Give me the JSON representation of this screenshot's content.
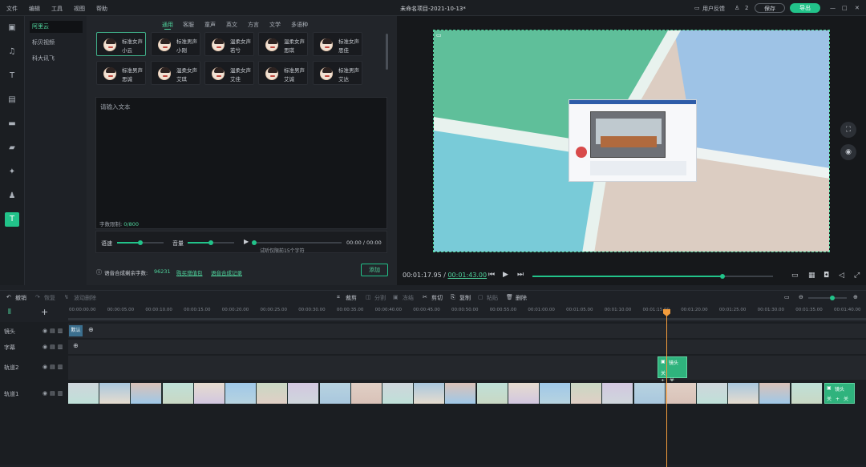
{
  "menu": [
    "文件",
    "编辑",
    "工具",
    "视图",
    "帮助"
  ],
  "window_title": "未命名项目-2021-10-13*",
  "topbar": {
    "feedback": "用户反馈",
    "user": "2",
    "save": "保存",
    "export": "导出",
    "minimize": "—",
    "maximize": "□",
    "close": "✕"
  },
  "providers": [
    "阿里云",
    "标贝视频",
    "科大讯飞"
  ],
  "voice_tabs": [
    "通用",
    "客服",
    "童声",
    "英文",
    "方言",
    "文学",
    "多语种"
  ],
  "voices": [
    {
      "line1": "标准女声",
      "line2": "小云"
    },
    {
      "line1": "标准男声",
      "line2": "小刚"
    },
    {
      "line1": "温柔女声",
      "line2": "若兮"
    },
    {
      "line1": "温柔女声",
      "line2": "思琪"
    },
    {
      "line1": "标准女声",
      "line2": "思佳"
    },
    {
      "line1": "标准男声",
      "line2": "思诚"
    },
    {
      "line1": "温柔女声",
      "line2": "艾琪"
    },
    {
      "line1": "温柔女声",
      "line2": "艾佳"
    },
    {
      "line1": "标准男声",
      "line2": "艾诚"
    },
    {
      "line1": "标准男声",
      "line2": "艾达"
    }
  ],
  "text_input": {
    "placeholder": "请输入文本",
    "limit_label": "字数限制: ",
    "limit_value": "0/800"
  },
  "controls": {
    "speed": "语速",
    "volume": "音量",
    "time": "00:00 / 00:00",
    "trial_note": "试听仅限前15个字符"
  },
  "footer": {
    "remaining_label": "语音合成剩余字数: ",
    "remaining_value": "96231",
    "buy": "购买增值包",
    "history": "语音合成记录",
    "add": "添加"
  },
  "preview": {
    "current_time": "00:01:17.95 / ",
    "total_time": "00:01:43.00"
  },
  "timeline_tools": {
    "undo": "撤销",
    "redo": "恢复",
    "ripple": "波动删除",
    "crop": "裁剪",
    "split": "分割",
    "freeze": "冻结",
    "cut": "剪切",
    "copy": "复制",
    "paste": "粘贴",
    "delete": "删除"
  },
  "ruler_ticks": [
    "00:00:00.00",
    "00:00:05.00",
    "00:00:10.00",
    "00:00:15.00",
    "00:00:20.00",
    "00:00:25.00",
    "00:00:30.00",
    "00:00:35.00",
    "00:00:40.00",
    "00:00:45.00",
    "00:00:50.00",
    "00:00:55.00",
    "00:01:00.00",
    "00:01:05.00",
    "00:01:10.00",
    "00:01:15.00",
    "00:01:20.00",
    "00:01:25.00",
    "00:01:30.00",
    "00:01:35.00",
    "00:01:40.00"
  ],
  "tracks": [
    {
      "label": "镜头"
    },
    {
      "label": "字幕"
    },
    {
      "label": "轨道2"
    },
    {
      "label": "轨道1"
    }
  ],
  "clips": {
    "default_shot": "默认",
    "shot_clip": "镜头",
    "end_clip": "镜头"
  },
  "colors": {
    "accent": "#22c38a",
    "playhead": "#f39c3c"
  }
}
